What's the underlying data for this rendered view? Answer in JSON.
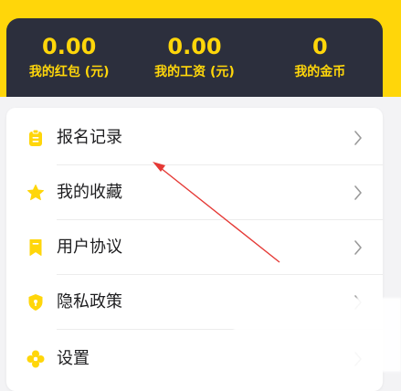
{
  "stats": [
    {
      "value": "0.00",
      "label": "我的红包 (元)"
    },
    {
      "value": "0.00",
      "label": "我的工资 (元)"
    },
    {
      "value": "0",
      "label": "我的金币"
    }
  ],
  "menu": {
    "items": [
      {
        "label": "报名记录",
        "icon": "clipboard-icon"
      },
      {
        "label": "我的收藏",
        "icon": "star-icon"
      },
      {
        "label": "用户协议",
        "icon": "bookmark-icon"
      },
      {
        "label": "隐私政策",
        "icon": "shield-icon"
      },
      {
        "label": "设置",
        "icon": "settings-icon"
      }
    ]
  },
  "colors": {
    "accent": "#ffd60a",
    "card_dark": "#2c2f3d",
    "annotation_arrow": "#e53935"
  }
}
